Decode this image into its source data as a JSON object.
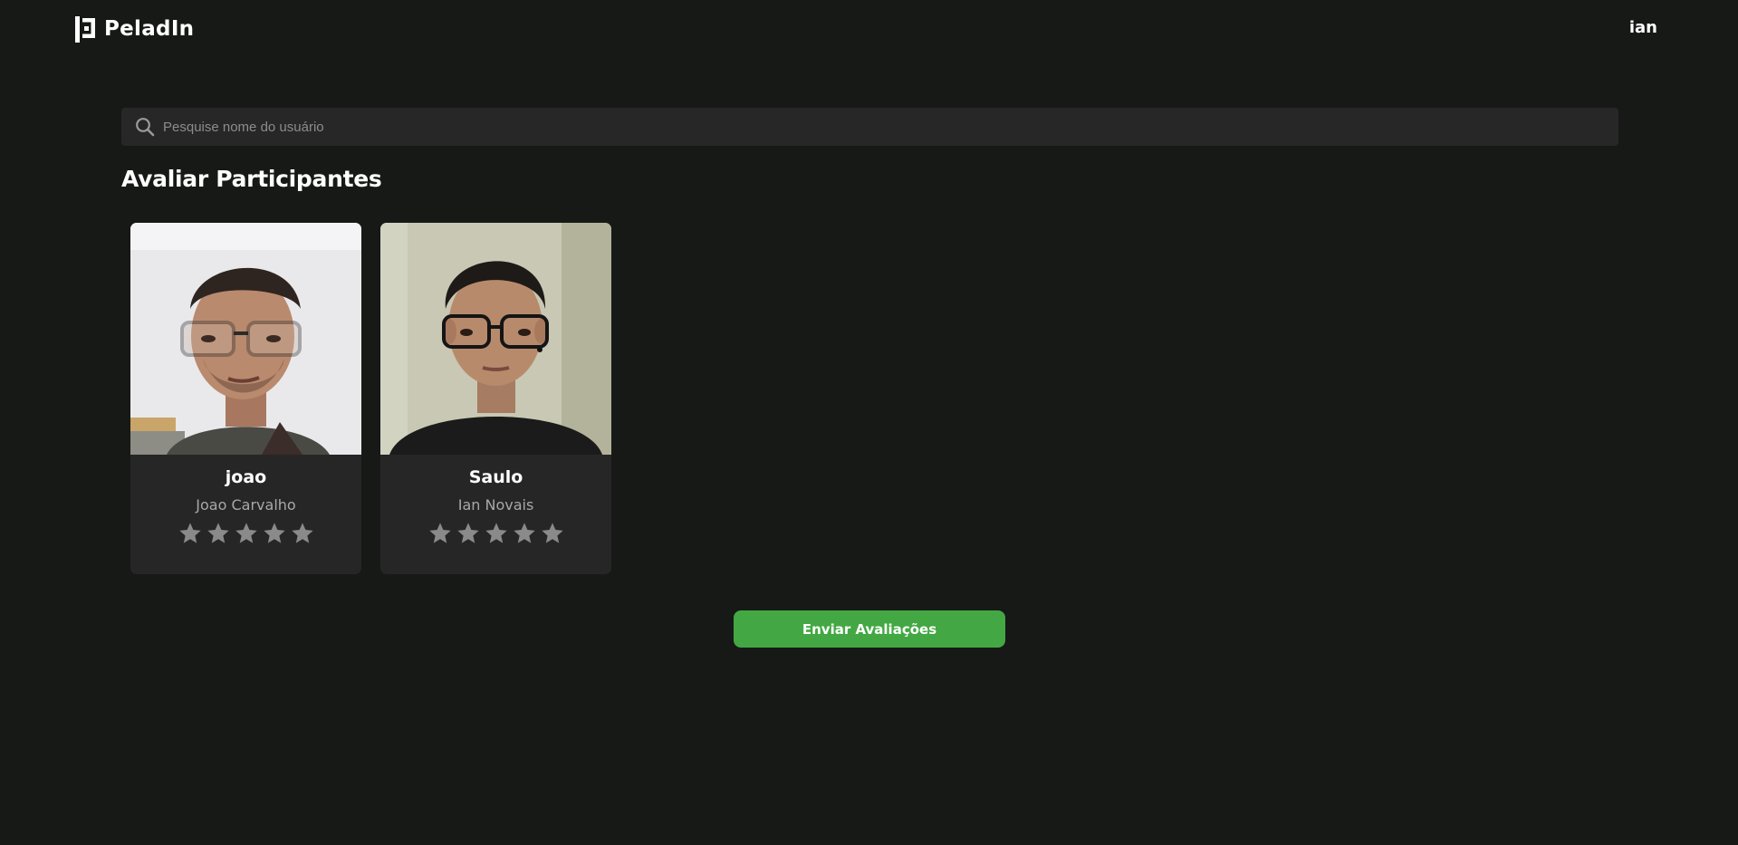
{
  "header": {
    "brand": "PeladIn",
    "user": "ian"
  },
  "search": {
    "placeholder": "Pesquise nome do usuário",
    "value": ""
  },
  "section": {
    "title": "Avaliar Participantes"
  },
  "participants": [
    {
      "username": "joao",
      "full_name": "Joao Carvalho",
      "rating": 0,
      "max_rating": 5
    },
    {
      "username": "Saulo",
      "full_name": "Ian Novais",
      "rating": 0,
      "max_rating": 5
    }
  ],
  "actions": {
    "submit_label": "Enviar Avaliações"
  },
  "colors": {
    "background": "#171917",
    "card": "#262626",
    "search": "#272727",
    "accent": "#43a843",
    "star_inactive": "#8a8a8a"
  }
}
